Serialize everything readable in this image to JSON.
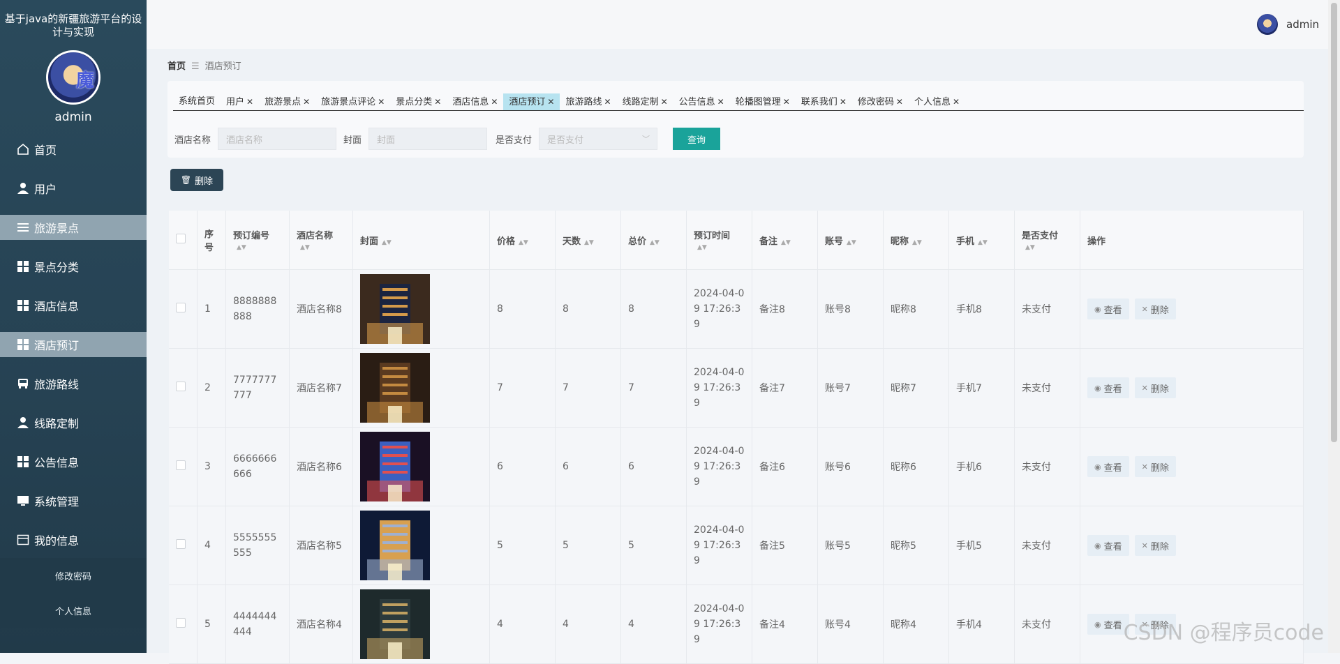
{
  "sidebar": {
    "title": "基于java的新疆旅游平台的设计与实现",
    "username": "admin",
    "menu": [
      {
        "label": "首页",
        "icon": "home-icon",
        "active": false
      },
      {
        "label": "用户",
        "icon": "user-icon",
        "active": false
      },
      {
        "label": "旅游景点",
        "icon": "list-icon",
        "active": true
      },
      {
        "label": "景点分类",
        "icon": "grid-icon",
        "active": false
      },
      {
        "label": "酒店信息",
        "icon": "grid-icon",
        "active": false
      },
      {
        "label": "酒店预订",
        "icon": "grid-icon",
        "active": true
      },
      {
        "label": "旅游路线",
        "icon": "bus-icon",
        "active": false
      },
      {
        "label": "线路定制",
        "icon": "user-icon",
        "active": false
      },
      {
        "label": "公告信息",
        "icon": "grid-icon",
        "active": false
      },
      {
        "label": "系统管理",
        "icon": "monitor-icon",
        "active": false
      },
      {
        "label": "我的信息",
        "icon": "card-icon",
        "active": false
      }
    ],
    "submenu": [
      "修改密码",
      "个人信息"
    ]
  },
  "topbar": {
    "username": "admin"
  },
  "breadcrumb": {
    "home": "首页",
    "current": "酒店预订"
  },
  "tabs": [
    {
      "label": "系统首页",
      "closable": false,
      "active": false
    },
    {
      "label": "用户",
      "closable": true,
      "active": false
    },
    {
      "label": "旅游景点",
      "closable": true,
      "active": false
    },
    {
      "label": "旅游景点评论",
      "closable": true,
      "active": false
    },
    {
      "label": "景点分类",
      "closable": true,
      "active": false
    },
    {
      "label": "酒店信息",
      "closable": true,
      "active": false
    },
    {
      "label": "酒店预订",
      "closable": true,
      "active": true
    },
    {
      "label": "旅游路线",
      "closable": true,
      "active": false
    },
    {
      "label": "线路定制",
      "closable": true,
      "active": false
    },
    {
      "label": "公告信息",
      "closable": true,
      "active": false
    },
    {
      "label": "轮播图管理",
      "closable": true,
      "active": false
    },
    {
      "label": "联系我们",
      "closable": true,
      "active": false
    },
    {
      "label": "修改密码",
      "closable": true,
      "active": false
    },
    {
      "label": "个人信息",
      "closable": true,
      "active": false
    }
  ],
  "filter": {
    "hotel_label": "酒店名称",
    "hotel_placeholder": "酒店名称",
    "cover_label": "封面",
    "cover_placeholder": "封面",
    "paid_label": "是否支付",
    "paid_placeholder": "是否支付",
    "query_button": "查询"
  },
  "toolbar": {
    "delete_button": "删除"
  },
  "table": {
    "headers": [
      "序号",
      "预订编号",
      "酒店名称",
      "封面",
      "价格",
      "天数",
      "总价",
      "预订时间",
      "备注",
      "账号",
      "昵称",
      "手机",
      "是否支付",
      "操作"
    ],
    "view_label": "查看",
    "delete_label": "删除",
    "rows": [
      {
        "no": "1",
        "code": "8888888888",
        "hotel": "酒店名称8",
        "price": "8",
        "days": "8",
        "total": "8",
        "time": "2024-04-09 17:26:39",
        "note": "备注8",
        "account": "账号8",
        "nick": "昵称8",
        "phone": "手机8",
        "paid": "未支付"
      },
      {
        "no": "2",
        "code": "7777777777",
        "hotel": "酒店名称7",
        "price": "7",
        "days": "7",
        "total": "7",
        "time": "2024-04-09 17:26:39",
        "note": "备注7",
        "account": "账号7",
        "nick": "昵称7",
        "phone": "手机7",
        "paid": "未支付"
      },
      {
        "no": "3",
        "code": "6666666666",
        "hotel": "酒店名称6",
        "price": "6",
        "days": "6",
        "total": "6",
        "time": "2024-04-09 17:26:39",
        "note": "备注6",
        "account": "账号6",
        "nick": "昵称6",
        "phone": "手机6",
        "paid": "未支付"
      },
      {
        "no": "4",
        "code": "5555555555",
        "hotel": "酒店名称5",
        "price": "5",
        "days": "5",
        "total": "5",
        "time": "2024-04-09 17:26:39",
        "note": "备注5",
        "account": "账号5",
        "nick": "昵称5",
        "phone": "手机5",
        "paid": "未支付"
      },
      {
        "no": "5",
        "code": "4444444444",
        "hotel": "酒店名称4",
        "price": "4",
        "days": "4",
        "total": "4",
        "time": "2024-04-09 17:26:39",
        "note": "备注4",
        "account": "账号4",
        "nick": "昵称4",
        "phone": "手机4",
        "paid": "未支付"
      }
    ]
  },
  "watermark": "CSDN @程序员code",
  "colors": {
    "sidebar": "#264253",
    "active_menu": "#90a4b0",
    "query_button": "#1aa39a",
    "delete_button": "#2c4555",
    "active_tab": "#b7e3f0"
  }
}
